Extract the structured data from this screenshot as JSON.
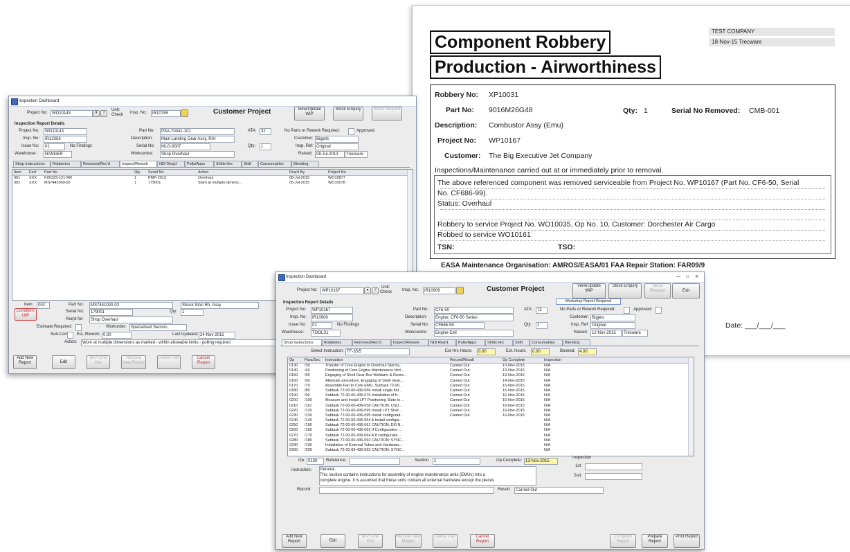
{
  "report": {
    "title1": "Component Robbery",
    "title2": "Production - Airworthiness",
    "company": "TEST COMPANY",
    "date_user": "18-Nov-15  Trecware",
    "robbery_no_label": "Robbery No:",
    "robbery_no": "XP10031",
    "part_no_label": "Part No:",
    "part_no": "9016M26G48",
    "qty_label": "Qty:",
    "qty": "1",
    "serial_removed_label": "Serial No Removed:",
    "serial_removed": "CMB-001",
    "description_label": "Description:",
    "description": "Combustor Assy (Emu)",
    "project_no_label": "Project No:",
    "project_no": "WP10167",
    "customer_label": "Customer:",
    "customer": "The Big Executive Jet Company",
    "inspections_heading": "Inspections/Maintenance carried out at or immediately prior to removal.",
    "note_line1": "The above referenced component was removed serviceable from Project No. WP10167 (Part No. CF6-50, Serial",
    "note_line2": "No. CF686-99).",
    "note_line3": "Status: Overhaul",
    "note_line4": "Robbery to service Project No. WO10035, Op No. 10, Customer: Dorchester Air Cargo",
    "note_line5": "Robbed to service WO10161",
    "tsn_label": "TSN:",
    "tso_label": "TSO:",
    "footer": "EASA Maintenance Organisation: AMROS/EASA/01      FAA Repair Station: FAR09/9",
    "date_label": "Date:  ___/___/___"
  },
  "back_window": {
    "title": "Inspection Dashboard",
    "project_label": "Project No:",
    "project_no": "WO10143",
    "unit_label": "Unit:",
    "unit_value": "Check",
    "insp_label": "Insp. No:",
    "insp_no": "IR10785",
    "heading": "Customer Project",
    "btn_view": "View/Update WIP",
    "btn_stock": "Stock Enquiry",
    "btn_request": "Stock Request",
    "section_label": "Inspection Report Details",
    "f_project_label": "Project No:",
    "f_project": "WO10143",
    "f_insp_label": "Insp. No:",
    "f_insp": "IR12356",
    "f_issue_label": "Issue No:",
    "f_issue": "01",
    "f_warehouse_label": "Warehouse:",
    "f_warehouse": "HANGER",
    "part_label": "Part No:",
    "part": "PSA-70041-101",
    "desc_label": "Description:",
    "desc": "Main Landing Gear Assy, R/H",
    "serial_label": "Serial No:",
    "serial": "MLG-0007",
    "workcentre_label": "Workcentre:",
    "workcentre": "Shop Overhaul",
    "ata_label": "ATA:",
    "ata": "32",
    "qty_label": "Qty:",
    "qty": "1",
    "noparts_label": "No Parts or Rework Required:",
    "approved_label": "Approved:",
    "customer_label": "Customer:",
    "customer": "Bigjets",
    "insp_ref_label": "Insp. Ref:",
    "insp_ref": "Original",
    "raised_label": "Raised:",
    "raised": "08-Jul-2013",
    "raised_by": "Trecware",
    "findings_label": "No Findings",
    "tabs": [
      "Shop Instructions",
      "Robberies",
      "Removed/Rec'd",
      "Inspect/Rework",
      "NDI Req'd",
      "Pulls/Apps",
      "Shifts Hrs",
      "Shift",
      "Consumables",
      "Blending"
    ],
    "grid_headers": [
      "Item",
      "Excl",
      "Part No",
      "Qty",
      "Serial No",
      "Action",
      "Req'd By",
      "Project No"
    ],
    "grid_rows": [
      [
        "001",
        "XXX",
        "F2K325-121-RR",
        "1",
        "PMP-2013",
        "Overhaul",
        "08-Jul-2015",
        "WO10877"
      ],
      [
        "002",
        "XXX",
        "MS7441000-02",
        "1",
        "179001",
        "Stam at multiple dimens...",
        "05-Jul-2015",
        "WO10078"
      ]
    ],
    "item_label": "Item:",
    "item": "002",
    "btn_condition": "Condition: U/P",
    "b_part_label": "Part No:",
    "b_part": "MS7441000-02",
    "b_desc": "Shock Strut Rh, Assy",
    "b_serial_label": "Serial No:",
    "b_serial": "179001",
    "b_qty_label": "Qty:",
    "b_qty": "1",
    "b_req_label": "Req'd for:",
    "b_req": "Shop Overhaul",
    "b_estimate_label": "Estimate Required:",
    "b_workorder_label": "Workorder:",
    "b_workorder": "Specialised Sectors",
    "b_subcon_label": "Sub-Con:",
    "b_estimate2_label": "Est. Rework:",
    "b_estimate2": "0.00",
    "b_last_label": "Last Updated:",
    "b_last": "24-Nov-2015",
    "b_action_label": "Action:",
    "b_action": "Worn at multiple dimensions as marked - within allowable limits - polling required",
    "btn_add": "Add New Report",
    "btn_edit": "Edit",
    "btn_kits": "WIP Over Kits",
    "btn_reissue": "Reissue New Report",
    "btn_delete": "Delete Part",
    "btn_cancel": "Cancel Report"
  },
  "front_window": {
    "title": "Inspection Dashboard",
    "project_label": "Project No:",
    "project_no": "WP10167",
    "unit_label": "Unit:",
    "unit_value": "Check",
    "insp_label": "Insp. No:",
    "insp_no": "IR10906",
    "heading": "Customer Project",
    "btn_view": "View/Update WIP",
    "btn_stock": "Stock Enquiry",
    "btn_request": "Stock Request",
    "btn_exit": "Exit",
    "workshop_note": "Workshop Report Required",
    "section_label": "Inspection Report Details",
    "f_project_label": "Project No:",
    "f_project": "WP10167",
    "f_insp_label": "Insp. No:",
    "f_insp": "IR10906",
    "f_issue_label": "Issue No:",
    "f_issue": "01",
    "f_warehouse_label": "Warehouse:",
    "f_warehouse": "TOOLS1",
    "part_label": "Part No:",
    "part": "CF6-50",
    "desc_label": "Description:",
    "desc": "Engine, CF6-50 Series",
    "serial_label": "Serial No:",
    "serial": "CF686-99",
    "workcentre_label": "Workcentre:",
    "workcentre": "Engine Cell",
    "ata_label": "ATA:",
    "ata": "72",
    "qty_label": "Qty:",
    "qty": "1",
    "noparts_label": "No Parts or Rework Required:",
    "approved_label": "Approved:",
    "customer_label": "Customer:",
    "customer": "Bigjets",
    "insp_ref_label": "Insp. Ref:",
    "insp_ref": "Original",
    "raised_label": "Raised:",
    "raised": "12-Nov-2015",
    "raised_by": "Trecware",
    "findings_label": "No Findings",
    "tabs": [
      "Shop Instructions",
      "Robberies",
      "Removed/Rec'd",
      "Inspect/Rework",
      "NDI Req'd",
      "Pulls/Apps",
      "Shifts Hrs",
      "Shift",
      "Consumables",
      "Blending"
    ],
    "select_label": "Select Instruction:",
    "select_value": "TF-35/5",
    "est_hours_label": "Est Hrs Hours:",
    "est_hours": "0.00",
    "est_hours2_label": "Est. Hours:",
    "est_hours2": "0.00",
    "booked_label": "Booked:",
    "booked": "4.00",
    "grid_headers": [
      "Op",
      "Para/Sec",
      "Instruction",
      "Record/Result",
      "Op Complete",
      "Inspection"
    ],
    "grid_rows": [
      [
        "0130",
        "/30",
        "Transfer of Core Engine to Overhaul Stat by...",
        "Carried Out",
        "13-Nov-2015",
        "N/A"
      ],
      [
        "0140",
        "/40",
        "Positioning of Core Engine Maintenance Mnt...",
        "Carried Out",
        "13-Nov-2015",
        "N/A"
      ],
      [
        "0150",
        "/50",
        "Engaging of Shell Gear Box Weldarm & Doors...",
        "Carried Out",
        "13-Nov-2015",
        "N/A"
      ],
      [
        "0160",
        "/60",
        "Alternate procedure, Engaging of Shell Gear...",
        "Carried Out",
        "14-Nov-2015",
        "N/A"
      ],
      [
        "0170",
        "/70",
        "Assemble Fan to Core EMU, Subtask 72-00...",
        "Carried Out",
        "15-Nov-2015",
        "N/A"
      ],
      [
        "0180",
        "/80",
        "Subtask 72-00-00-436-056 Install single flat...",
        "Carried Out",
        "15-Nov-2015",
        "N/A"
      ],
      [
        "0190",
        "/90",
        "Subtask 72-00-00-436-076 Installation of fr...",
        "Carried Out",
        "16-Nov-2015",
        "N/A"
      ],
      [
        "0200",
        "/100",
        "Measure and Install LPT Positioning Stats to ...",
        "Carried Out",
        "16-Nov-2015",
        "N/A"
      ],
      [
        "0210",
        "/110",
        "Subtask 72-00-00-436-058 CAUTION: USU...",
        "Carried Out",
        "16-Nov-2015",
        "N/A"
      ],
      [
        "0220",
        "/120",
        "Subtask 72-00-00-436-095 Install LPT Shaf...",
        "Carried Out",
        "16-Nov-2015",
        "N/A"
      ],
      [
        "0230",
        "/130",
        "Subtask 72-00-00-436-099 Install configurati...",
        "Carried Out",
        "16-Nov-2015",
        "N/A"
      ],
      [
        "0240",
        "/140",
        "Subtask 72-00-00-436-054 A Install configur...",
        "",
        "",
        "N/A"
      ],
      [
        "0250",
        "/150",
        "Subtask 72-00-00-436-061 CAUTION: DO N...",
        "",
        "",
        "N/A"
      ],
      [
        "0260",
        "/160",
        "Subtask 72-00-00-436-062 If Configuration ...",
        "",
        "",
        "N/A"
      ],
      [
        "0270",
        "/170",
        "Subtask 72-00-00-436-064 A If configuratio...",
        "",
        "",
        "N/A"
      ],
      [
        "0280",
        "/180",
        "Subtask 72-00-00-436-092 CAUTION: SYNC...",
        "",
        "",
        "N/A"
      ],
      [
        "0290",
        "/190",
        "Installation of External Tubes and Hardware...",
        "",
        "",
        "N/A"
      ],
      [
        "0300",
        "/200",
        "Subtask 72-00-00-436-093 CAUTION: SYNC...",
        "",
        "",
        "N/A"
      ]
    ],
    "op_label": "Op:",
    "op": "0130",
    "reference_label": "Reference:",
    "section2_label": "Section:",
    "section2": "1",
    "op_complete_label": "Op Complete:",
    "op_complete": "13-Nov-2015",
    "inspection_label": "Inspection",
    "insp1_label": "1st:",
    "insp2_label": "2nd:",
    "instruction_label": "Instruction:",
    "instruction_text1": "General.",
    "instruction_text2": "This section contains instructions for assembly of engine maintenance units (EMUs) into a",
    "instruction_text3": "complete engine. It is assumed that these units contain all external hardware except the pieces",
    "record_label": "Record:",
    "result_label": "Result:",
    "result": "Carried Out",
    "btn_add": "Add New Report",
    "btn_edit": "Edit",
    "btn_kits": "WIP Over Kits",
    "btn_reissue": "Reissue New Report",
    "btn_delete": "Delete Part",
    "btn_cancel": "Cancel Report",
    "btn_complete": "Complete Report",
    "btn_prepare": "Prepare Report",
    "btn_print": "Print Report"
  },
  "colors": {
    "accent_blue": "#3c6cb6",
    "highlight_yellow": "#fff7a8",
    "cancel_red": "#c02020"
  }
}
